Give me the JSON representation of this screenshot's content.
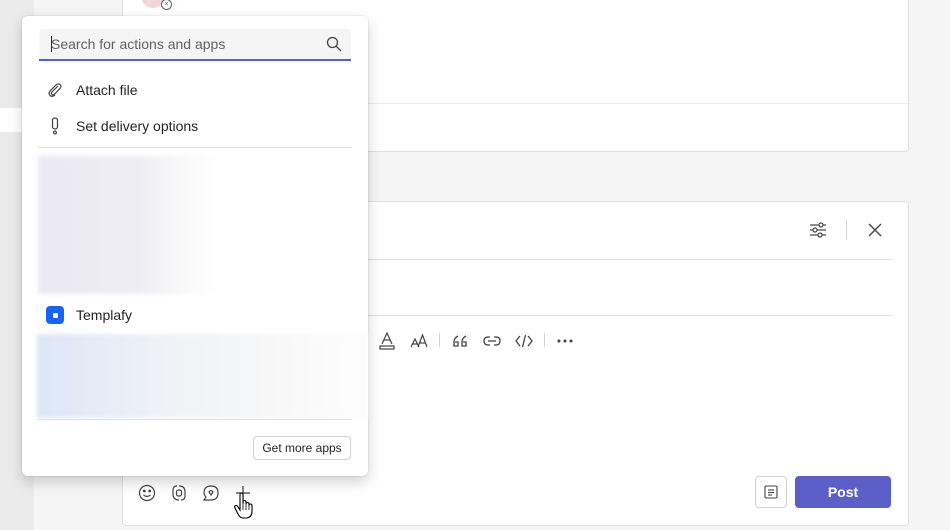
{
  "popup": {
    "search": {
      "placeholder": "Search for actions and apps",
      "icon": "search-icon"
    },
    "items": [
      {
        "label": "Attach file",
        "icon": "paperclip-icon"
      },
      {
        "label": "Set delivery options",
        "icon": "exclamation-icon"
      }
    ],
    "apps": [
      {
        "label": "Templafy",
        "icon": "templafy-logo",
        "color": "#1a62f2"
      }
    ],
    "get_more_label": "Get more apps"
  },
  "compose": {
    "post_label": "Post",
    "accent_color": "#5b5fc7",
    "header_icons": [
      "sliders-icon",
      "close-icon"
    ],
    "format_icons": [
      "font-color-icon",
      "font-size-icon",
      "quote-icon",
      "link-icon",
      "code-icon",
      "more-icon"
    ],
    "bottom_icons": [
      "emoji-icon",
      "loop-icon",
      "praise-icon",
      "plus-icon"
    ]
  }
}
